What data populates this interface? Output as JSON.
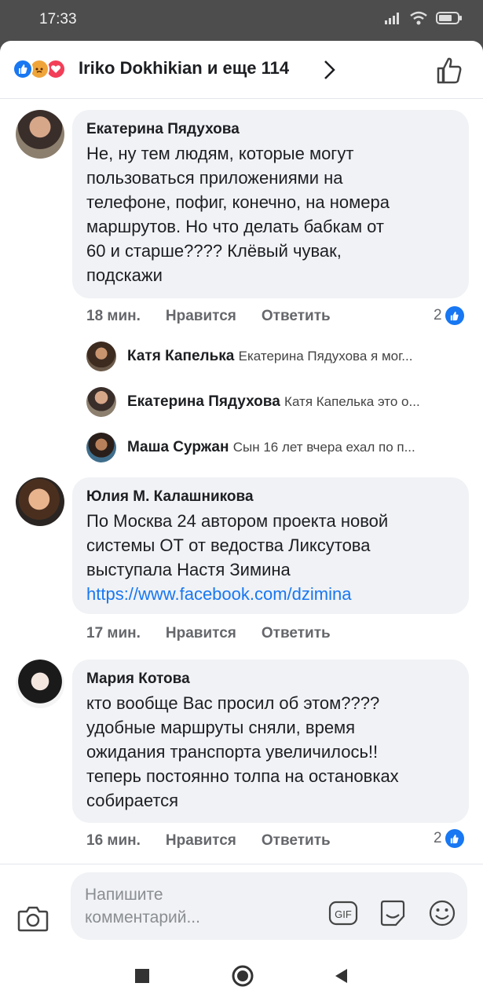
{
  "status_bar": {
    "time": "17:33"
  },
  "header": {
    "names": "Iriko Dokhikian и еще 114"
  },
  "comments": [
    {
      "author": "Екатерина Пядухова",
      "text": "Не, ну тем людям, которые могут\nпользоваться приложениями на\nтелефоне, пофиг, конечно, на номера\nмаршрутов. Но что делать бабкам от\n60 и старше???? Клёвый чувак,\nподскажи",
      "time": "18 мин.",
      "like": "Нравится",
      "reply": "Ответить",
      "likes": "2"
    },
    {
      "author": "Юлия М. Калашникова",
      "text": "По Москва 24 автором проекта новой\nсистемы ОТ от ведоства Ликсутова\nвыступала  Настя Зимина",
      "link": "https://www.facebook.com/dzimina",
      "time": "17 мин.",
      "like": "Нравится",
      "reply": "Ответить"
    },
    {
      "author": "Мария Котова",
      "text": "кто вообще Вас просил об этом????\nудобные маршруты сняли, время\nожидания транспорта увеличилось!!\nтеперь постоянно толпа на остановках\nсобирается",
      "time": "16 мин.",
      "like": "Нравится",
      "reply": "Ответить",
      "likes": "2"
    }
  ],
  "replies": [
    {
      "author": "Катя Капелька",
      "text": "Екатерина Пядухова я мог..."
    },
    {
      "author": "Екатерина Пядухова",
      "text": "Катя Капелька это о..."
    },
    {
      "author": "Маша Суржан",
      "text": "Сын 16 лет вчера ехал по п..."
    }
  ],
  "composer": {
    "placeholder": "Напишите\nкомментарий..."
  },
  "colors": {
    "accent": "#1877f2",
    "bubble": "#f0f2f5",
    "meta": "#65676b"
  },
  "icons": [
    "like-reaction-icon",
    "angry-reaction-icon",
    "love-reaction-icon",
    "chevron-right-icon",
    "thumbs-up-icon",
    "camera-icon",
    "gif-icon",
    "sticker-icon",
    "emoji-icon"
  ]
}
